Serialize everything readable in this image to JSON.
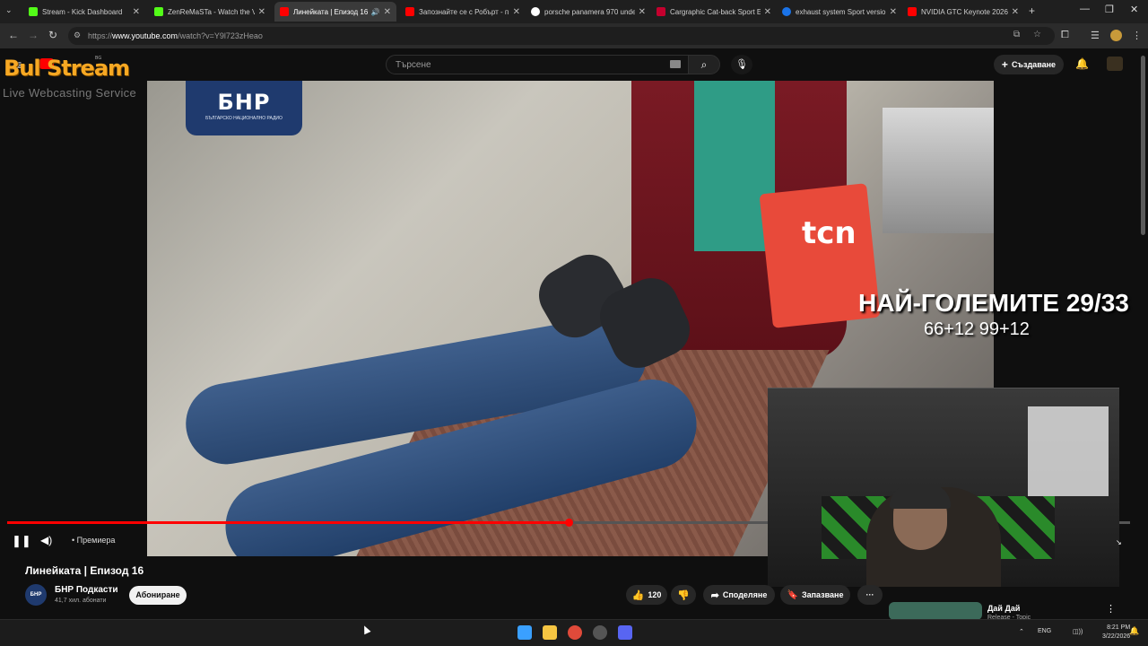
{
  "browser": {
    "tabs": [
      {
        "title": "Stream - Kick Dashboard",
        "favicon_color": "#53fc18"
      },
      {
        "title": "ZenReMaSTa - Watch the VO",
        "favicon_color": "#53fc18"
      },
      {
        "title": "Линейката | Епизод 16",
        "favicon_color": "#ff0000"
      },
      {
        "title": "Запознайте се с Робърт - п",
        "favicon_color": "#ff0000"
      },
      {
        "title": "porsche panamera 970 unde",
        "favicon_color": "#4285f4"
      },
      {
        "title": "Cargraphic Cat-back Sport E",
        "favicon_color": "#c4002e"
      },
      {
        "title": "exhaust system Sport version",
        "favicon_color": "#1a73e8"
      },
      {
        "title": "NVIDIA GTC Keynote 2026 -",
        "favicon_color": "#ff0000"
      }
    ],
    "url_prefix": "https://",
    "url_host": "www.youtube.com",
    "url_path": "/watch?v=Y9l723zHeao"
  },
  "youtube": {
    "search_placeholder": "Търсене",
    "create_label": "Създаване",
    "logo_region": "BG"
  },
  "overlay": {
    "brand": "Bul Stream",
    "brand_sub": "Live Webcasting Service",
    "title": "НАЙ-ГОЛЕМИТЕ 29/33",
    "subtitle": "66+12 99+12"
  },
  "video_content": {
    "channel_logo_text": "БНР",
    "channel_logo_sub": "БЪЛГАРСКО НАЦИОНАЛНО РАДИО",
    "bag_logo": "tcn"
  },
  "player": {
    "premiere_label": "• Премиера",
    "progress": 0.5
  },
  "video": {
    "title": "Линейката | Епизод 16",
    "channel": "БНР Подкасти",
    "subscribers": "41,7 хил. абонати",
    "subscribe_label": "Абониране",
    "likes": "120",
    "share_label": "Споделяне",
    "save_label": "Запазване"
  },
  "sidebar": {
    "item_title": "Дай Дай",
    "item_channel": "Release - Topic"
  },
  "taskbar": {
    "lang": "ENG",
    "time": "8:21 PM",
    "date": "3/22/2026"
  }
}
